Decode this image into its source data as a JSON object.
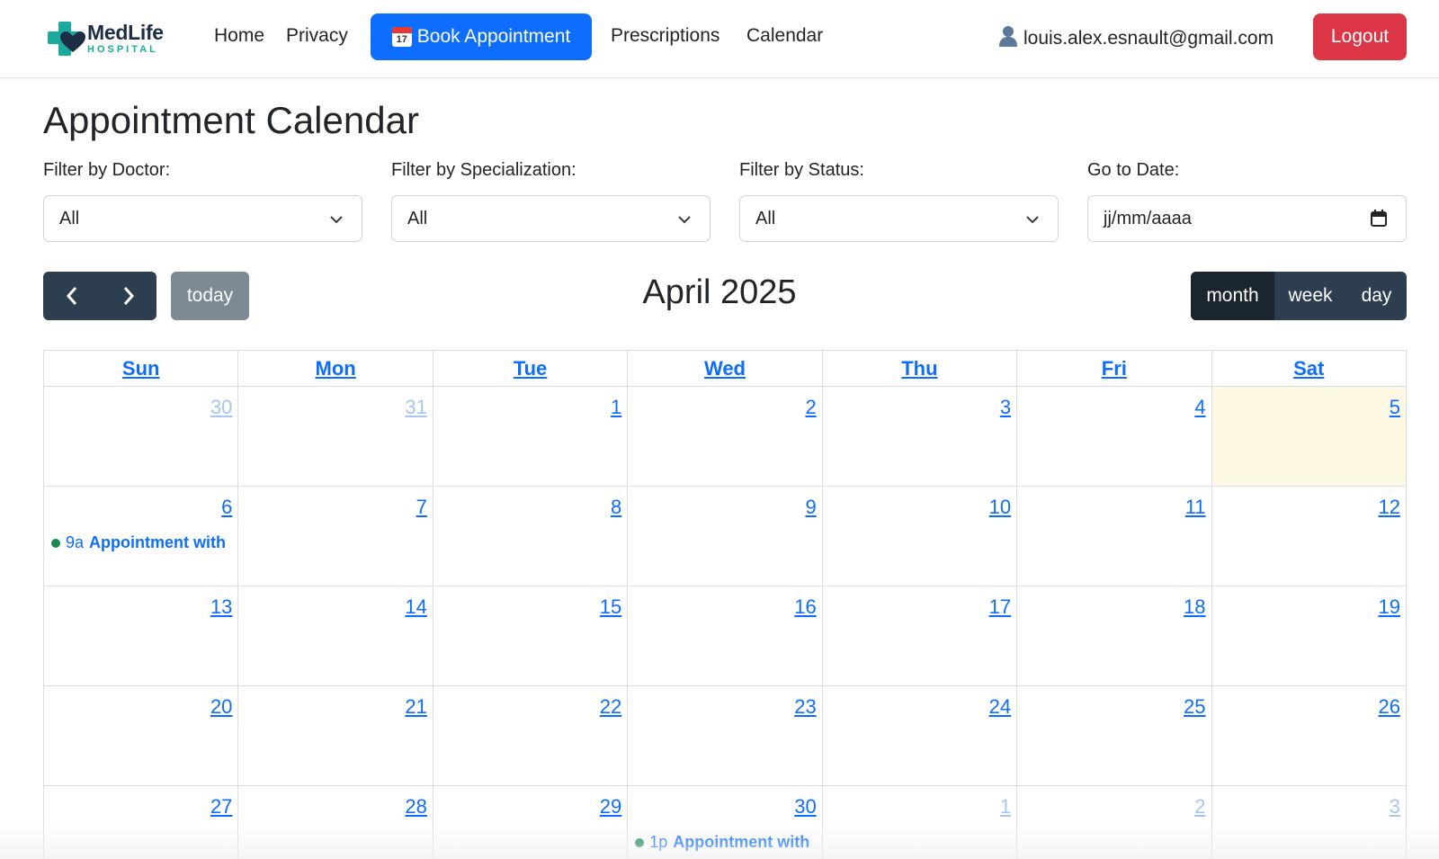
{
  "navbar": {
    "brand_name": "MedLife",
    "brand_sub": "HOSPITAL",
    "links": [
      "Home",
      "Privacy"
    ],
    "book_label": "Book Appointment",
    "book_icon_number": "17",
    "links_right": [
      "Prescriptions",
      "Calendar"
    ],
    "user_email": "louis.alex.esnault@gmail.com",
    "logout_label": "Logout",
    "book_color": "#0d6efd",
    "logout_color": "#dc3545"
  },
  "page": {
    "title": "Appointment Calendar"
  },
  "filters": {
    "doctor": {
      "label": "Filter by Doctor:",
      "value": "All"
    },
    "specialization": {
      "label": "Filter by Specialization:",
      "value": "All"
    },
    "status": {
      "label": "Filter by Status:",
      "value": "All"
    },
    "date": {
      "label": "Go to Date:",
      "placeholder": "jj/mm/aaaa"
    }
  },
  "toolbar": {
    "today_label": "today",
    "title": "April 2025",
    "views": [
      "month",
      "week",
      "day"
    ],
    "active_view": "month"
  },
  "calendar": {
    "weekdays": [
      "Sun",
      "Mon",
      "Tue",
      "Wed",
      "Thu",
      "Fri",
      "Sat"
    ],
    "weeks": [
      [
        "30",
        "31",
        "1",
        "2",
        "3",
        "4",
        "5"
      ],
      [
        "6",
        "7",
        "8",
        "9",
        "10",
        "11",
        "12"
      ],
      [
        "13",
        "14",
        "15",
        "16",
        "17",
        "18",
        "19"
      ],
      [
        "20",
        "21",
        "22",
        "23",
        "24",
        "25",
        "26"
      ],
      [
        "27",
        "28",
        "29",
        "30",
        "1",
        "2",
        "3"
      ]
    ],
    "other_month_cells": [
      [
        0,
        0
      ],
      [
        0,
        1
      ],
      [
        4,
        4
      ],
      [
        4,
        5
      ],
      [
        4,
        6
      ]
    ],
    "today_cell": [
      0,
      6
    ],
    "events": [
      {
        "week": 1,
        "day": 0,
        "time": "9a",
        "title": "Appointment with",
        "status_color": "#198754"
      },
      {
        "week": 4,
        "day": 3,
        "time": "1p",
        "title": "Appointment with",
        "status_color": "#198754"
      }
    ]
  }
}
